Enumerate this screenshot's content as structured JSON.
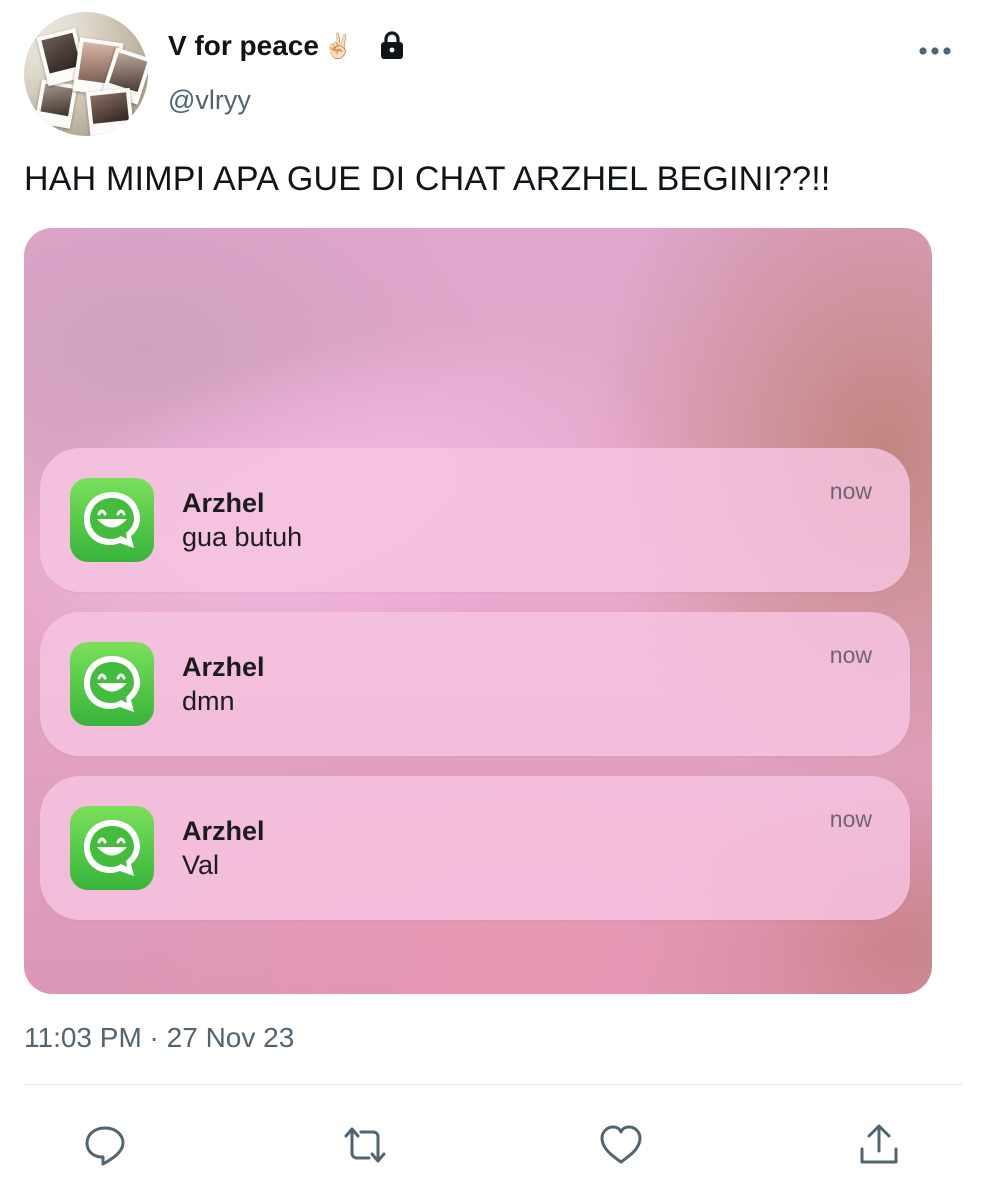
{
  "author": {
    "display_name": "V for peace",
    "name_emoji": "✌🏻",
    "handle": "@vlryy",
    "protected_icon": "lock-icon"
  },
  "more_menu_icon": "more-horizontal-icon",
  "tweet": {
    "text": "HAH MIMPI APA GUE DI CHAT ARZHEL BEGINI??!!",
    "timestamp": "11:03 PM · 27 Nov 23"
  },
  "media": {
    "notifications": [
      {
        "app_icon": "whatsapp-icon",
        "sender": "Arzhel",
        "message": "gua butuh",
        "time": "now"
      },
      {
        "app_icon": "whatsapp-icon",
        "sender": "Arzhel",
        "message": "dmn",
        "time": "now"
      },
      {
        "app_icon": "whatsapp-icon",
        "sender": "Arzhel",
        "message": "Val",
        "time": "now"
      }
    ]
  },
  "actions": [
    {
      "icon": "reply-icon"
    },
    {
      "icon": "retweet-icon"
    },
    {
      "icon": "like-icon"
    },
    {
      "icon": "share-icon"
    }
  ],
  "colors": {
    "text_primary": "#0f1419",
    "text_secondary": "#536471",
    "divider": "#e3e7ea",
    "app_icon_green": "#37b43a",
    "notification_bg": "#f6c4e2"
  }
}
